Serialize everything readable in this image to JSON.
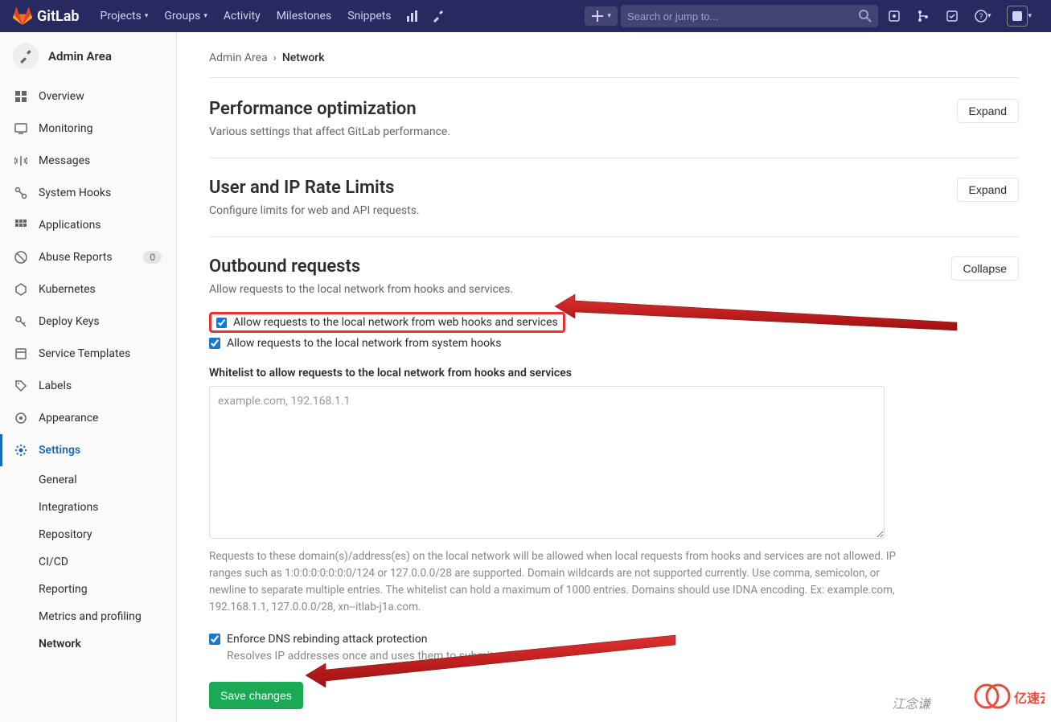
{
  "topnav": {
    "brand": "GitLab",
    "items": [
      "Projects",
      "Groups",
      "Activity",
      "Milestones",
      "Snippets"
    ],
    "search_placeholder": "Search or jump to..."
  },
  "sidebar": {
    "title": "Admin Area",
    "items": [
      {
        "label": "Overview"
      },
      {
        "label": "Monitoring"
      },
      {
        "label": "Messages"
      },
      {
        "label": "System Hooks"
      },
      {
        "label": "Applications"
      },
      {
        "label": "Abuse Reports",
        "badge": "0"
      },
      {
        "label": "Kubernetes"
      },
      {
        "label": "Deploy Keys"
      },
      {
        "label": "Service Templates"
      },
      {
        "label": "Labels"
      },
      {
        "label": "Appearance"
      },
      {
        "label": "Settings"
      }
    ],
    "settings_sub": [
      "General",
      "Integrations",
      "Repository",
      "CI/CD",
      "Reporting",
      "Metrics and profiling",
      "Network"
    ]
  },
  "breadcrumb": {
    "root": "Admin Area",
    "sep": "›",
    "current": "Network"
  },
  "sections": {
    "perf": {
      "title": "Performance optimization",
      "desc": "Various settings that affect GitLab performance.",
      "btn": "Expand"
    },
    "rate": {
      "title": "User and IP Rate Limits",
      "desc": "Configure limits for web and API requests.",
      "btn": "Expand"
    },
    "out": {
      "title": "Outbound requests",
      "desc": "Allow requests to the local network from hooks and services.",
      "btn": "Collapse",
      "check1": "Allow requests to the local network from web hooks and services",
      "check2": "Allow requests to the local network from system hooks",
      "whitelist_label": "Whitelist to allow requests to the local network from hooks and services",
      "whitelist_placeholder": "example.com, 192.168.1.1",
      "whitelist_help": "Requests to these domain(s)/address(es) on the local network will be allowed when local requests from hooks and services are not allowed. IP ranges such as 1:0:0:0:0:0:0:0/124 or 127.0.0.0/28 are supported. Domain wildcards are not supported currently. Use comma, semicolon, or newline to separate multiple entries. The whitelist can hold a maximum of 1000 entries. Domains should use IDNA encoding. Ex: example.com, 192.168.1.1, 127.0.0.0/28, xn--itlab-j1a.com.",
      "check3": "Enforce DNS rebinding attack protection",
      "check3_help": "Resolves IP addresses once and uses them to submit requests",
      "save": "Save changes"
    }
  },
  "watermark": "江念谦",
  "watermark_brand": "亿速云"
}
